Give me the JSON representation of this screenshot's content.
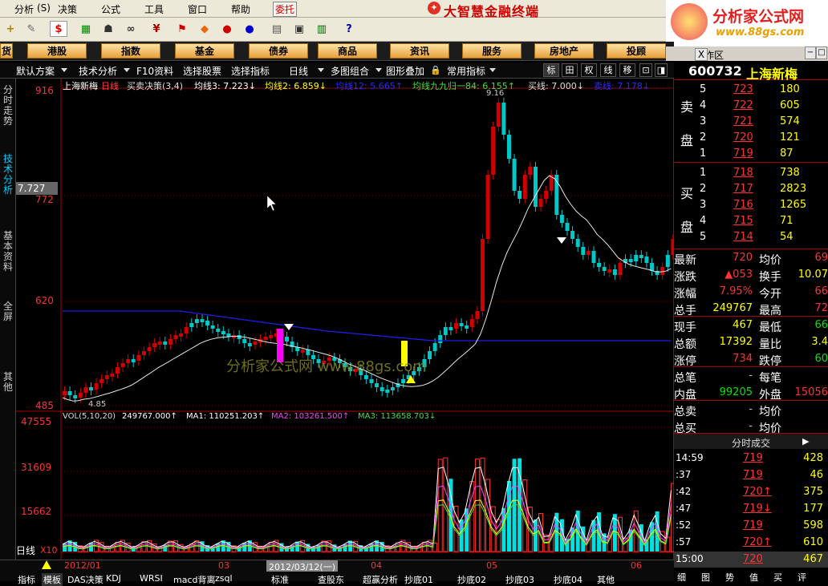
{
  "menu": [
    "分析",
    "决策",
    "公式",
    "工具",
    "窗口",
    "帮助"
  ],
  "menu_hot": "委托",
  "app_title": "大智慧金融终端",
  "logo": {
    "line1": "分析家公式网",
    "line2": "www.88gs.com"
  },
  "categories": [
    "港股",
    "指数",
    "基金",
    "债券",
    "商品",
    "资讯",
    "服务",
    "房地产",
    "投顾"
  ],
  "cat_left": "货",
  "work_area": "工作区",
  "close_label": "X",
  "subtool": [
    "默认方案",
    "技术分析",
    "F10资料",
    "选择股票",
    "选择指标",
    "日线",
    "多图组合",
    "图形叠加",
    "常用指标"
  ],
  "subtool_btns": [
    "标",
    "田",
    "权",
    "线",
    "移"
  ],
  "left_tabs": [
    "分时走势",
    "技术分析",
    "基本资料",
    "全屏",
    "其他"
  ],
  "chart": {
    "header": "上海新梅",
    "period": "日线",
    "indicator": "买卖决策(3,4)",
    "ma3_label": "均线3: 7.223↓",
    "ma2_label": "均线2: 6.859↓",
    "ma12_label": "均线12: 5.665↑",
    "ma99_label": "均线九九归一84: 6.155↑",
    "buy_label": "买线: 7.000↓",
    "sell_label": "卖线: 7.178↓",
    "price_ticks": [
      "916",
      "772",
      "620",
      "485"
    ],
    "cursor_price": "7.727",
    "low_label": "4.85",
    "high_label": "9.16",
    "watermark": "分析家公式网 www.88gs.com",
    "vol_header": "VOL(5,10,20)",
    "vol_value": "249767.000↑",
    "ma1_label": "MA1: 110251.203↑",
    "ma2v_label": "MA2: 103261.500↑",
    "ma3v_label": "MA3: 113658.703↓",
    "vol_ticks": [
      "47555",
      "31609",
      "15662"
    ],
    "vol_unit": "X10",
    "x_labels": [
      "2012/01",
      "03",
      "04",
      "05",
      "06"
    ],
    "date_cursor": "2012/03/12(一)",
    "bottom_period": "日线"
  },
  "bottom_tabs": [
    "指标",
    "模板",
    "DAS决策",
    "KDJ",
    "WRSI",
    "macd背离",
    "zsql",
    "标准",
    "查股东",
    "超赢分析",
    "抄底01",
    "抄底02",
    "抄底03",
    "抄底04",
    "其他"
  ],
  "quote": {
    "code": "600732",
    "name": "上海新梅",
    "sell_label": [
      "卖",
      "盘"
    ],
    "buy_label": [
      "买",
      "盘"
    ],
    "sells": [
      {
        "n": "5",
        "p": "723",
        "v": "180"
      },
      {
        "n": "4",
        "p": "722",
        "v": "605"
      },
      {
        "n": "3",
        "p": "721",
        "v": "574"
      },
      {
        "n": "2",
        "p": "720",
        "v": "121"
      },
      {
        "n": "1",
        "p": "719",
        "v": "87"
      }
    ],
    "buys": [
      {
        "n": "1",
        "p": "718",
        "v": "738"
      },
      {
        "n": "2",
        "p": "717",
        "v": "2823"
      },
      {
        "n": "3",
        "p": "716",
        "v": "1265"
      },
      {
        "n": "4",
        "p": "715",
        "v": "71"
      },
      {
        "n": "5",
        "p": "714",
        "v": "54"
      }
    ],
    "stats": [
      {
        "k1": "最新",
        "v1": "720",
        "k2": "均价",
        "v2": "69"
      },
      {
        "k1": "涨跌",
        "v1": "▲053",
        "k2": "换手",
        "v2": "10.07"
      },
      {
        "k1": "涨幅",
        "v1": "7.95%",
        "k2": "今开",
        "v2": "66"
      },
      {
        "k1": "总手",
        "v1": "249767",
        "k2": "最高",
        "v2": "72"
      },
      {
        "k1": "现手",
        "v1": "467",
        "k2": "最低",
        "v2": "66"
      },
      {
        "k1": "总额",
        "v1": "17392",
        "k2": "量比",
        "v2": "3.4"
      },
      {
        "k1": "涨停",
        "v1": "734",
        "k2": "跌停",
        "v2": "60"
      },
      {
        "k1": "总笔",
        "v1": "-",
        "k2": "每笔",
        "v2": ""
      },
      {
        "k1": "内盘",
        "v1": "99205",
        "k2": "外盘",
        "v2": "15056"
      },
      {
        "k1": "总卖",
        "v1": "-",
        "k2": "均价",
        "v2": ""
      },
      {
        "k1": "总买",
        "v1": "-",
        "k2": "均价",
        "v2": ""
      }
    ],
    "ticks_title": "分时成交",
    "ticks": [
      {
        "t": "14:59",
        "p": "719",
        "v": "428",
        "a": ""
      },
      {
        "t": ":37",
        "p": "719",
        "v": "46",
        "a": ""
      },
      {
        "t": ":42",
        "p": "720↑",
        "v": "375",
        "a": ""
      },
      {
        "t": ":47",
        "p": "719↓",
        "v": "177",
        "a": ""
      },
      {
        "t": ":52",
        "p": "719",
        "v": "598",
        "a": ""
      },
      {
        "t": ":57",
        "p": "720↑",
        "v": "610",
        "a": ""
      },
      {
        "t": "15:00",
        "p": "720",
        "v": "467",
        "a": ""
      }
    ],
    "bottom_tabs": [
      "细",
      "图",
      "势",
      "值",
      "买",
      "评"
    ]
  }
}
